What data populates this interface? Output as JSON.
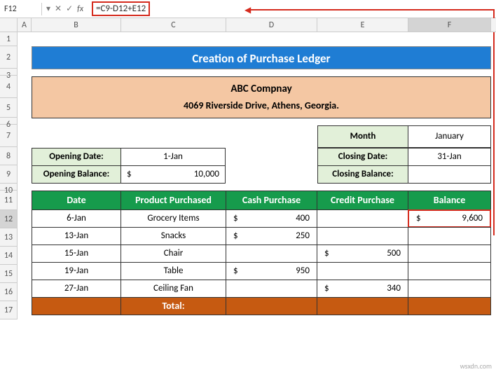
{
  "formula_bar": {
    "cell_ref": "F12",
    "formula": "=C9-D12+E12",
    "fx_label": "fx",
    "cancel": "✕",
    "accept": "✓",
    "dropdown": "▾"
  },
  "columns": [
    "A",
    "B",
    "C",
    "D",
    "E",
    "F"
  ],
  "rows": [
    "1",
    "2",
    "3",
    "4",
    "5",
    "6",
    "7",
    "8",
    "9",
    "10",
    "11",
    "12",
    "13",
    "14",
    "15",
    "16",
    "17"
  ],
  "title": "Creation of Purchase Ledger",
  "company": {
    "name": "ABC Compnay",
    "address": "4069 Riverside Drive, Athens, Georgia."
  },
  "info": {
    "month_label": "Month",
    "month_value": "January",
    "opening_date_label": "Opening Date:",
    "opening_date_value": "1-Jan",
    "closing_date_label": "Closing Date:",
    "closing_date_value": "31-Jan",
    "opening_balance_label": "Opening Balance:",
    "opening_balance_currency": "$",
    "opening_balance_value": "10,000",
    "closing_balance_label": "Closing Balance:"
  },
  "table": {
    "headers": {
      "date": "Date",
      "product": "Product Purchased",
      "cash": "Cash Purchase",
      "credit": "Credit Purchase",
      "balance": "Balance"
    },
    "rows": [
      {
        "date": "6-Jan",
        "product": "Grocery Items",
        "cash_s": "$",
        "cash": "400",
        "credit_s": "",
        "credit": "",
        "bal_s": "$",
        "bal": "9,600"
      },
      {
        "date": "13-Jan",
        "product": "Snacks",
        "cash_s": "$",
        "cash": "250",
        "credit_s": "",
        "credit": "",
        "bal_s": "",
        "bal": ""
      },
      {
        "date": "15-Jan",
        "product": "Chair",
        "cash_s": "",
        "cash": "",
        "credit_s": "$",
        "credit": "500",
        "bal_s": "",
        "bal": ""
      },
      {
        "date": "19-Jan",
        "product": "Table",
        "cash_s": "$",
        "cash": "950",
        "credit_s": "",
        "credit": "",
        "bal_s": "",
        "bal": ""
      },
      {
        "date": "27-Jan",
        "product": "Ceiling Fan",
        "cash_s": "",
        "cash": "",
        "credit_s": "$",
        "credit": "340",
        "bal_s": "",
        "bal": ""
      }
    ],
    "total_label": "Total:"
  },
  "watermark": "wsxdn.com"
}
